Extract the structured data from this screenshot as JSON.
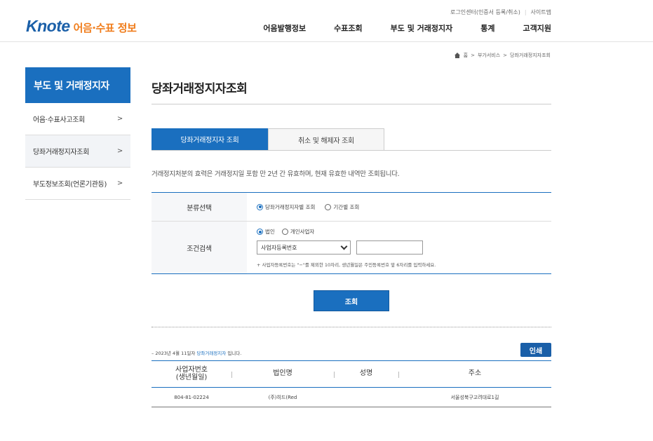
{
  "header": {
    "logo_brand": "Knote",
    "logo_sub": "어음·수표 정보",
    "util_links": [
      "로그인센터(인증서 등록/취소)",
      "사이트맵"
    ],
    "gnb": [
      "어음발행정보",
      "수표조회",
      "부도 및 거래정지자",
      "통계",
      "고객지원"
    ]
  },
  "breadcrumb": [
    "홈",
    ">",
    "부가서비스",
    ">",
    "당좌거래정지자조회"
  ],
  "sidebar": {
    "title": "부도 및 거래정지자",
    "items": [
      {
        "label": "어음·수표사고조회"
      },
      {
        "label": "당좌거래정지자조회"
      },
      {
        "label": "부도정보조회(언론기관등)"
      }
    ]
  },
  "main": {
    "title": "당좌거래정지자조회",
    "tabs": [
      {
        "label": "당좌거래정지자 조회"
      },
      {
        "label": "취소 및 해제자 조회"
      }
    ],
    "notice": "거래정지처분의 효력은 거래정지일 포함 만 2년 간 유효하며, 현재 유효한 내역만 조회됩니다.",
    "form": {
      "category_label": "분류선택",
      "category_options": [
        "당좌거래정지자별 조회",
        "기간별 조회"
      ],
      "condition_label": "조건검색",
      "type_options": [
        "법인",
        "개인사업자"
      ],
      "select_value": "사업자등록번호",
      "input_value": "",
      "hint": "+ 사업자등록번호는 \"−\"를 제외한 10자리, 생년월일은 주민등록번호 앞 6자리를 입력하세요."
    },
    "search_button": "조회",
    "result": {
      "date_prefix": "– 2023년 4월 11일자 ",
      "date_highlight": "당좌거래정지자",
      "date_suffix": " 입니다.",
      "print_button": "인쇄",
      "columns": [
        "사업자번호\n(생년월일)",
        "법인명",
        "성명",
        "주소"
      ],
      "col1_line1": "사업자번호",
      "col1_line2": "(생년월일)",
      "rows": [
        {
          "biz_no": "804-81-02224",
          "corp": "(주)히드(Red",
          "name": "",
          "address": "서울성북구고려대로1길"
        }
      ]
    }
  },
  "colors": {
    "primary": "#1a6fbf",
    "logo_blue": "#1a5fa8",
    "logo_orange": "#f07d1c"
  }
}
